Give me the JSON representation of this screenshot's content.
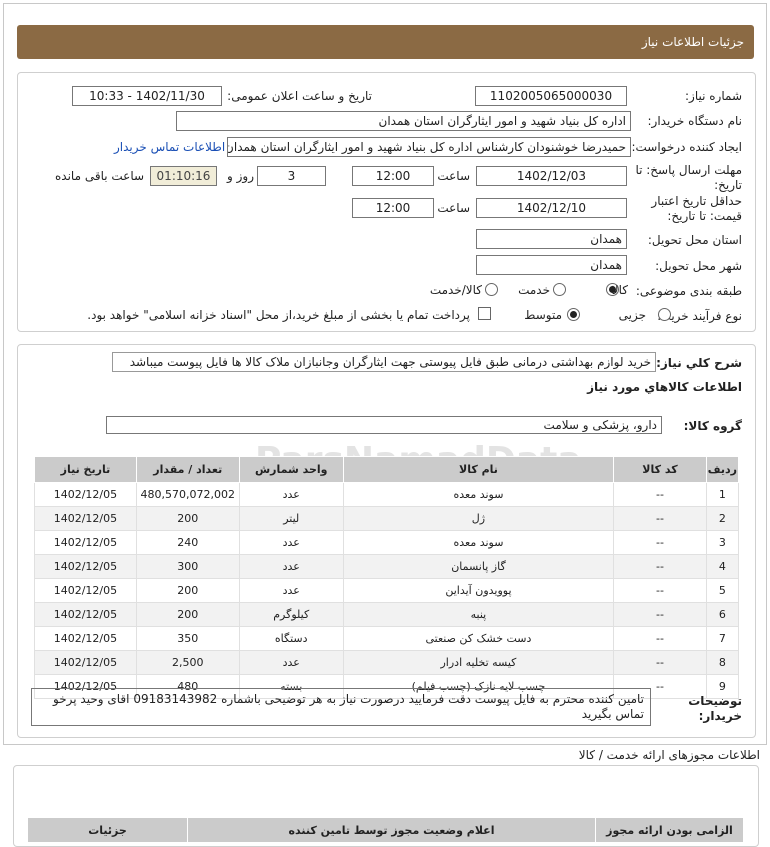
{
  "header": {
    "title": "جزئیات اطلاعات نیاز"
  },
  "form": {
    "need_number_label": "شماره نیاز:",
    "need_number": "1102005065000030",
    "announce_label": "تاریخ و ساعت اعلان عمومی:",
    "announce_value": "1402/11/30 - 10:33",
    "buyer_org_label": "نام دستگاه خریدار:",
    "buyer_org": "اداره کل بنیاد شهید و امور ایثارگران استان همدان",
    "creator_label": "ایجاد کننده درخواست:",
    "creator": "حمیدرضا خوشنودان کارشناس اداره کل بنیاد شهید و امور ایثارگران استان همدان",
    "contact_link": "اطلاعات تماس خریدار",
    "deadline_label_line1": "مهلت ارسال پاسخ: تا",
    "deadline_label_line2": "تاریخ:",
    "deadline_date": "1402/12/03",
    "time_label": "ساعت",
    "deadline_time": "12:00",
    "days_value": "3",
    "days_label": "روز و",
    "remaining_time": "01:10:16",
    "remaining_label": "ساعت باقی مانده",
    "validity_label_line1": "حداقل تاریخ اعتبار",
    "validity_label_line2": "قیمت: تا تاریخ:",
    "validity_date": "1402/12/10",
    "validity_time": "12:00",
    "province_label": "استان محل تحویل:",
    "province": "همدان",
    "city_label": "شهر محل تحویل:",
    "city": "همدان",
    "category_label": "طبقه بندی موضوعی:",
    "category_options": [
      "کالا",
      "خدمت",
      "کالا/خدمت"
    ],
    "category_selected": "کالا",
    "process_label": "نوع فرآیند خرید :",
    "process_options": [
      "جزیی",
      "متوسط"
    ],
    "process_selected": "متوسط",
    "payment_note": "پرداخت تمام یا بخشی از مبلغ خرید،از محل \"اسناد خزانه اسلامی\" خواهد بود."
  },
  "details": {
    "summary_label": "شرح کلي نياز:",
    "summary": "خرید لوازم بهداشتی درمانی طبق فایل پیوستی جهت ایثارگران وجانبازان ملاک کالا ها فایل پیوست میباشد",
    "goods_info_title": "اطلاعات کالاهاي مورد نياز",
    "goods_group_label": "گروه کالا:",
    "goods_group": "دارو، پزشکی و سلامت",
    "table_headers": [
      "رديف",
      "کد کالا",
      "نام کالا",
      "واحد شمارش",
      "تعداد / مقدار",
      "تاریخ نیاز"
    ],
    "rows": [
      [
        "1",
        "--",
        "سوند معده",
        "عدد",
        "480,570,072,002",
        "1402/12/05"
      ],
      [
        "2",
        "--",
        "ژل",
        "لیتر",
        "200",
        "1402/12/05"
      ],
      [
        "3",
        "--",
        "سوند معده",
        "عدد",
        "240",
        "1402/12/05"
      ],
      [
        "4",
        "--",
        "گاز پانسمان",
        "عدد",
        "300",
        "1402/12/05"
      ],
      [
        "5",
        "--",
        "پوویدون آیداین",
        "عدد",
        "200",
        "1402/12/05"
      ],
      [
        "6",
        "--",
        "پنبه",
        "کیلوگرم",
        "200",
        "1402/12/05"
      ],
      [
        "7",
        "--",
        "دست خشک کن صنعتی",
        "دستگاه",
        "350",
        "1402/12/05"
      ],
      [
        "8",
        "--",
        "کیسه تخلیه ادرار",
        "عدد",
        "2,500",
        "1402/12/05"
      ],
      [
        "9",
        "--",
        "چسب لایه نازک (چسب فیلم)",
        "بسته",
        "480",
        "1402/12/05"
      ]
    ],
    "notes_label_line1": "توضیحات",
    "notes_label_line2": "خریدار:",
    "notes": "تامین کننده محترم به فایل پیوست دقت فرمایید درصورت نیاز به هر توضیحی باشماره 09183143982 اقای وحید پرخو تماس بگیرید"
  },
  "permits": {
    "title": "اطلاعات مجوزهای ارائه خدمت / کالا",
    "headers": [
      "الزامی بودن ارائه مجوز",
      "اعلام وضعیت مجوز توسط تامین کننده",
      "جزئیات"
    ]
  },
  "watermark": {
    "line1": "ParsNamadData",
    "line2": "مرکز فرآیند اطلاعات پارس نماد داده",
    "line3": "پایگاه اطلاع رسانی مناقصات و مزایده",
    "line4": "۰۲۱-۸۸۳۴۹۶۷۰"
  }
}
